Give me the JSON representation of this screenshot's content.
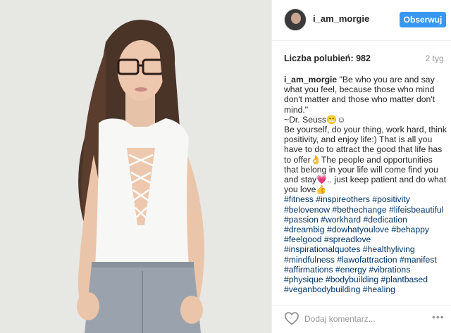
{
  "post": {
    "image_alt": "Photo of a young woman with long brown hair and glasses wearing a white lace-up bodysuit and grey jeans",
    "icons": {
      "like": "heart-outline-icon",
      "more": "more-options-icon"
    },
    "colors": {
      "follow_button": "#3897f0",
      "hashtags": "#003569",
      "muted": "#999999"
    }
  },
  "header": {
    "username": "i_am_morgie",
    "follow_label": "Obserwuj"
  },
  "meta": {
    "likes": "Liczba polubień: 982",
    "time": "2 tyg."
  },
  "caption": {
    "username": "i_am_morgie",
    "text": " \"Be who you are and say what you feel, because those who mind don't matter and those who matter don't mind.\"\n~Dr. Seuss😬☺\nBe yourself, do your thing, work hard, think positivity, and enjoy life:) That is all you have to do to attract the good that life has to offer👌The people and opportunities that belong in your life will come find you and stay💗.. just keep patient and do what you love👍",
    "hashtags": "#fitness #inspireothers #positivity #belovenow #bethechange #lifeisbeautiful #passion #workhard #dedication #dreambig #dowhatyoulove #behappy #feelgood #spreadlove #inspirationalquotes #healthyliving #mindfulness #lawofattraction #manifest #affirmations #energy #vibrations #physique #bodybuilding #plantbased #veganbodybuilding #healing"
  },
  "comment": {
    "placeholder": "Dodaj komentarz...",
    "more": "•••"
  }
}
